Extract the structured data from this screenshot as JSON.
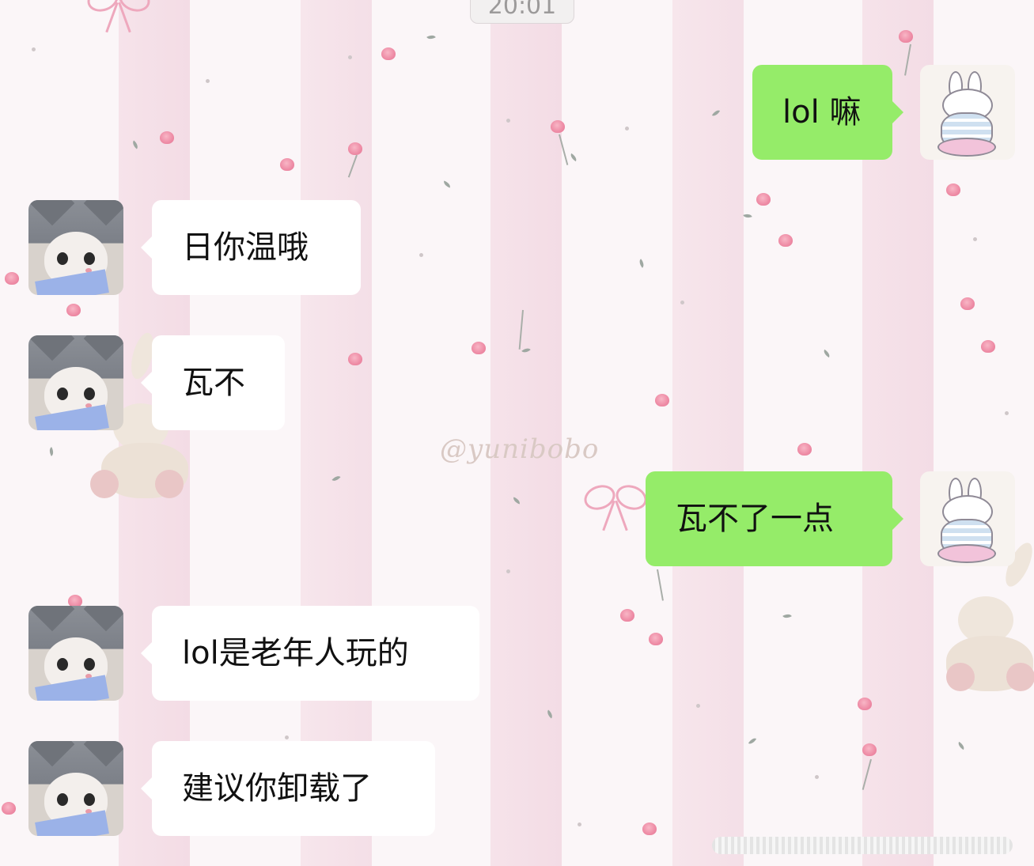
{
  "time_chip": "20:01",
  "watermark": "@yunibobo",
  "messages": [
    {
      "side": "right",
      "sender": "bunny",
      "text": "lol 嘛"
    },
    {
      "side": "left",
      "sender": "cat",
      "text": "日你温哦"
    },
    {
      "side": "left",
      "sender": "cat",
      "text": "瓦不"
    },
    {
      "side": "right",
      "sender": "bunny",
      "text": "瓦不了一点"
    },
    {
      "side": "left",
      "sender": "cat",
      "text": "lol是老年人玩的"
    },
    {
      "side": "left",
      "sender": "cat",
      "text": "建议你卸载了"
    }
  ],
  "colors": {
    "sent_bubble": "#95ec69",
    "received_bubble": "#ffffff",
    "wallpaper_stripe": "#f3dce5",
    "rose": "#ee8ba5"
  },
  "icons": {
    "received_avatar": "cat-avatar",
    "sent_avatar": "bunny-avatar"
  }
}
